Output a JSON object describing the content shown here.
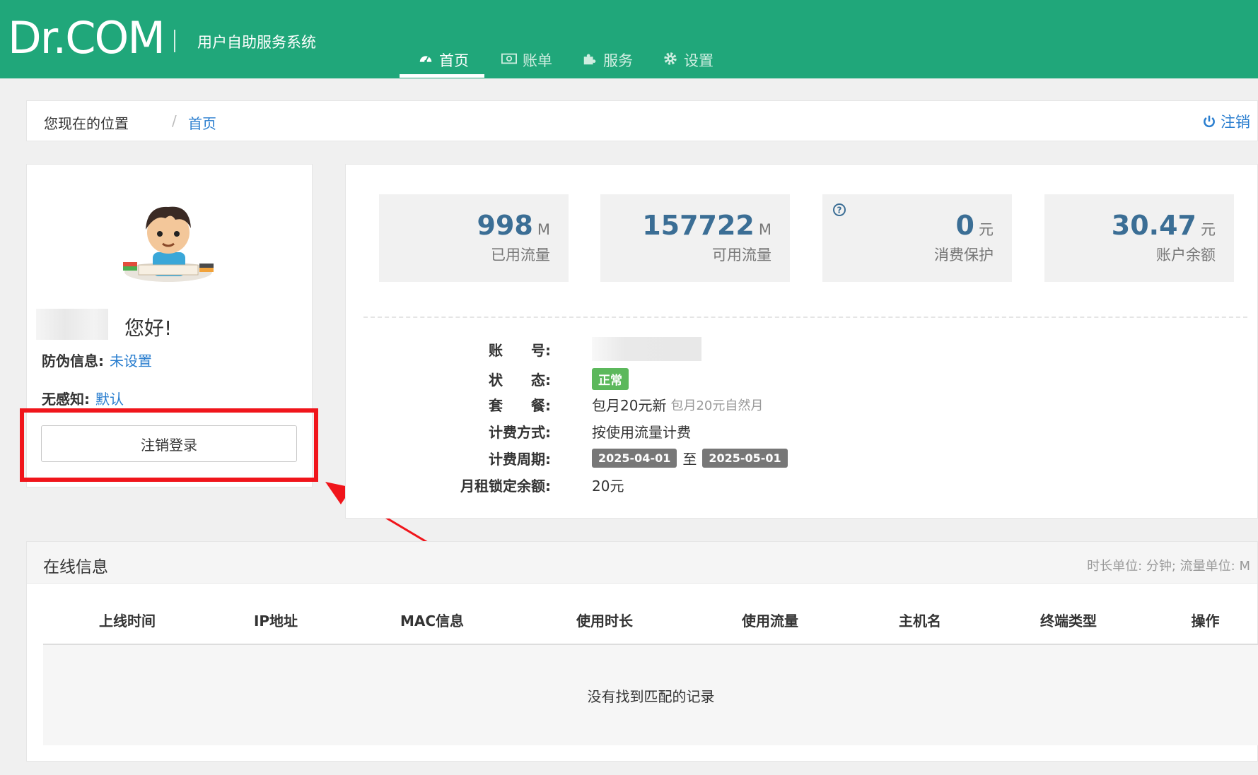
{
  "header": {
    "logo": "Dr.COM",
    "subtitle": "用户自助服务系统",
    "nav": [
      {
        "label": "首页",
        "icon": "dashboard-icon",
        "active": true
      },
      {
        "label": "账单",
        "icon": "money-icon",
        "active": false
      },
      {
        "label": "服务",
        "icon": "puzzle-icon",
        "active": false
      },
      {
        "label": "设置",
        "icon": "gear-icon",
        "active": false
      }
    ]
  },
  "breadcrumb": {
    "label": "您现在的位置",
    "separator": "/",
    "current": "首页",
    "logout": "注销"
  },
  "user": {
    "greeting": "您好!",
    "anti_fraud_label": "防伪信息:",
    "anti_fraud_value": "未设置",
    "seamless_label": "无感知:",
    "seamless_value": "默认",
    "logout_button": "注销登录"
  },
  "stats": [
    {
      "value": "998",
      "unit": "M",
      "label": "已用流量"
    },
    {
      "value": "157722",
      "unit": "M",
      "label": "可用流量"
    },
    {
      "value": "0",
      "unit": "元",
      "label": "消费保护",
      "help_icon": "question-circle-icon"
    },
    {
      "value": "30.47",
      "unit": "元",
      "label": "账户余额"
    }
  ],
  "details": {
    "account_label": "账　　号:",
    "status_label": "状　　态:",
    "status_value": "正常",
    "package_label": "套　　餐:",
    "package_value": "包月20元新",
    "package_note": "包月20元自然月",
    "billing_label": "计费方式:",
    "billing_value": "按使用流量计费",
    "period_label": "计费周期:",
    "period_start": "2025-04-01",
    "period_to": "至",
    "period_end": "2025-05-01",
    "locked_label": "月租锁定余额:",
    "locked_value": "20元"
  },
  "online": {
    "title": "在线信息",
    "units": "时长单位: 分钟; 流量单位: M",
    "columns": [
      "上线时间",
      "IP地址",
      "MAC信息",
      "使用时长",
      "使用流量",
      "主机名",
      "终端类型",
      "操作"
    ],
    "empty": "没有找到匹配的记录"
  },
  "colors": {
    "brand_green": "#20a77a",
    "link_blue": "#2a7ecf",
    "stat_blue": "#3b6e95",
    "highlight_red": "#f0151b"
  }
}
